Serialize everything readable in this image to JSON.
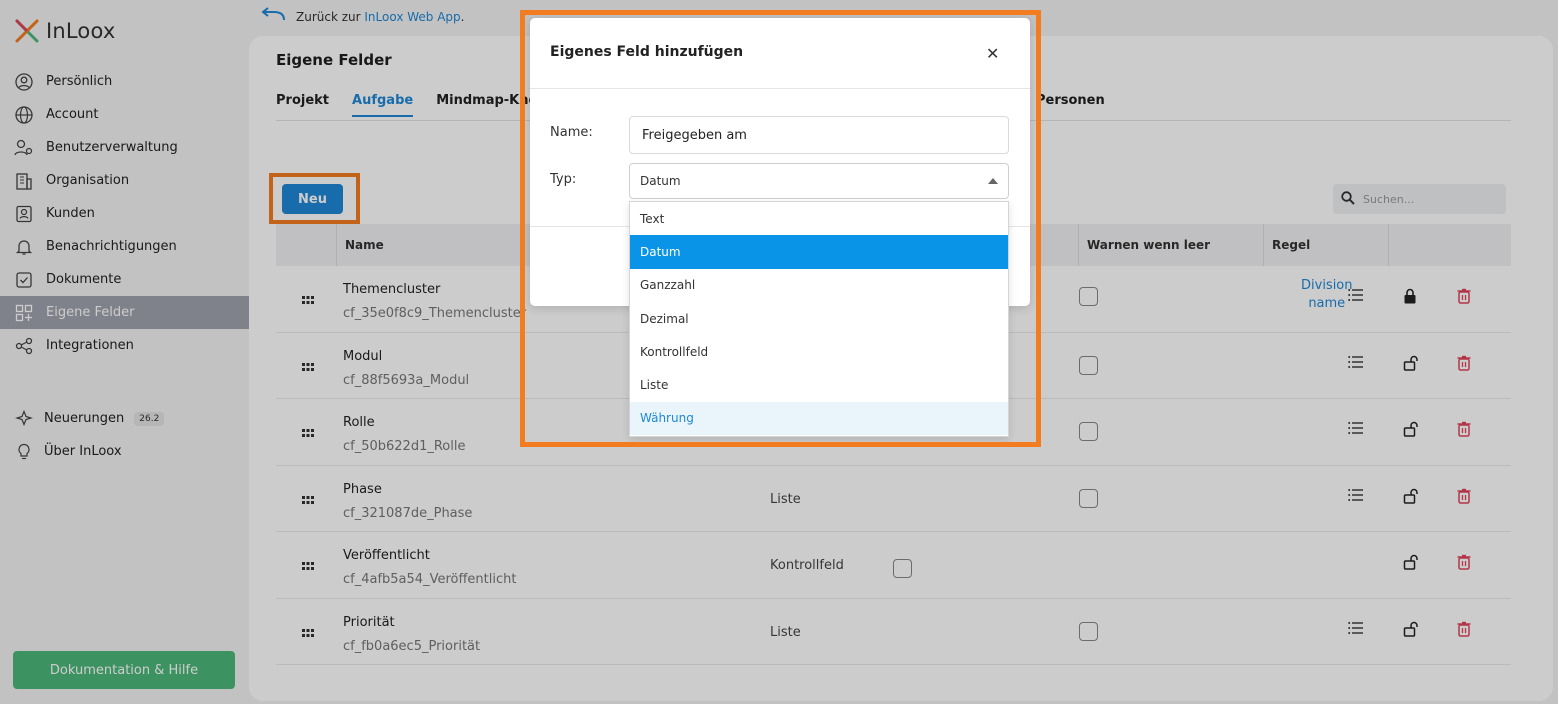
{
  "sidebar": {
    "logo": "InLoox",
    "items": [
      {
        "label": "Persönlich",
        "icon": "user-circle-icon"
      },
      {
        "label": "Account",
        "icon": "globe-icon"
      },
      {
        "label": "Benutzerverwaltung",
        "icon": "users-settings-icon"
      },
      {
        "label": "Organisation",
        "icon": "building-icon"
      },
      {
        "label": "Kunden",
        "icon": "contact-card-icon"
      },
      {
        "label": "Benachrichtigungen",
        "icon": "bell-icon"
      },
      {
        "label": "Dokumente",
        "icon": "document-check-icon"
      },
      {
        "label": "Eigene Felder",
        "icon": "grid-plus-icon",
        "active": true
      },
      {
        "label": "Integrationen",
        "icon": "share-nodes-icon"
      }
    ],
    "secondary": [
      {
        "label": "Neuerungen",
        "badge": "26.2",
        "icon": "sparkle-icon"
      },
      {
        "label": "Über InLoox",
        "icon": "lightbulb-icon"
      }
    ],
    "help_button": "Dokumentation & Hilfe"
  },
  "topbar": {
    "back_prefix": "Zurück zur ",
    "back_link": "InLoox Web App",
    "back_suffix": "."
  },
  "main": {
    "title": "Eigene Felder",
    "tabs": [
      "Projekt",
      "Aufgabe",
      "Mindmap-Knoten"
    ],
    "tab_extra": "Personen",
    "active_tab": "Aufgabe",
    "new_button": "Neu",
    "search_placeholder": "Suchen...",
    "columns": {
      "name": "Name",
      "warn": "Warnen wenn leer",
      "rule": "Regel"
    },
    "rows": [
      {
        "name": "Themencluster",
        "key": "cf_35e0f8c9_Themencluster",
        "type": "",
        "rule1": "Division",
        "rule2": "name",
        "locked": true
      },
      {
        "name": "Modul",
        "key": "cf_88f5693a_Modul",
        "type": "",
        "rule1": "",
        "rule2": "",
        "locked": false
      },
      {
        "name": "Rolle",
        "key": "cf_50b622d1_Rolle",
        "type": "",
        "rule1": "",
        "rule2": "",
        "locked": false
      },
      {
        "name": "Phase",
        "key": "cf_321087de_Phase",
        "type": "Liste",
        "rule1": "",
        "rule2": "",
        "locked": false
      },
      {
        "name": "Veröffentlicht",
        "key": "cf_4afb5a54_Veröffentlicht",
        "type": "Kontrollfeld",
        "rule1": "",
        "rule2": "",
        "locked": false
      },
      {
        "name": "Priorität",
        "key": "cf_fb0a6ec5_Priorität",
        "type": "Liste",
        "rule1": "",
        "rule2": "",
        "locked": false
      }
    ]
  },
  "dialog": {
    "title": "Eigenes Feld hinzufügen",
    "name_label": "Name:",
    "name_value": "Freigegeben am",
    "type_label": "Typ:",
    "type_value": "Datum",
    "options": [
      "Text",
      "Datum",
      "Ganzzahl",
      "Dezimal",
      "Kontrollfeld",
      "Liste",
      "Währung"
    ],
    "selected_option": "Datum",
    "hover_option": "Währung"
  },
  "colors": {
    "accent": "#1e88d6",
    "highlight": "#f47c20",
    "help_green": "#4cb87a",
    "delete_red": "#e0455a"
  }
}
